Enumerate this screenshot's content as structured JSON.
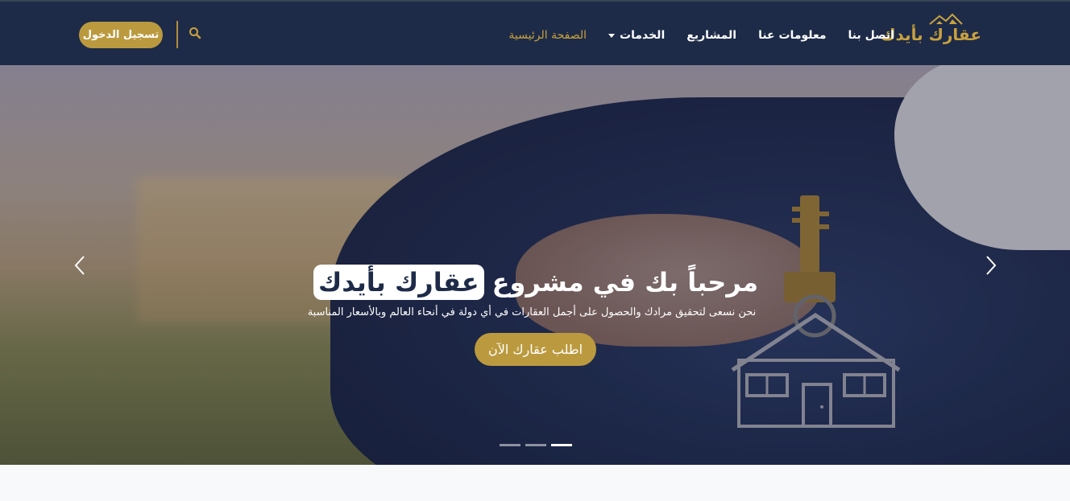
{
  "brand": {
    "name": "عقارك بأيدك"
  },
  "nav": {
    "items": [
      {
        "label": "الصفحة الرئيسية",
        "active": true
      },
      {
        "label": "الخدمات",
        "dropdown": true
      },
      {
        "label": "المشاريع"
      },
      {
        "label": "معلومات عنا"
      },
      {
        "label": "اتصل بنا"
      }
    ],
    "login_label": "تسجيل الدخول"
  },
  "hero": {
    "title_prefix": "مرحباً بك في مشروع",
    "title_highlight": "عقارك بأيدك",
    "subtitle": "نحن نسعى لتحقيق مرادك والحصول على أجمل العقارات في أي دولة في أنحاء العالم وبالأسعار المناسبة",
    "cta_label": "اطلب عقارك الآن",
    "slides_count": 3,
    "active_slide": 3
  },
  "colors": {
    "navbar": "#1d2b48",
    "accent": "#bb9a3f",
    "brand_gold": "#c9a13e"
  },
  "icons": {
    "search": "search-icon",
    "prev": "chevron-left-icon",
    "next": "chevron-right-icon",
    "caret": "caret-down-icon"
  }
}
